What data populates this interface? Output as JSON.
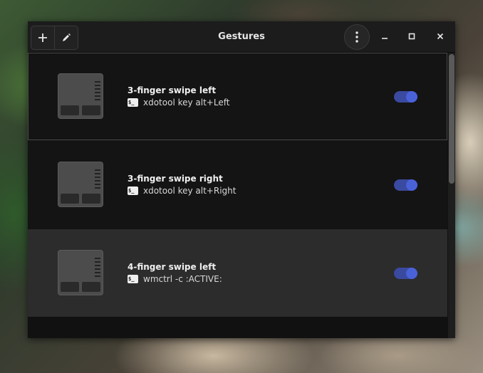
{
  "window": {
    "title": "Gestures"
  },
  "headerbar": {
    "add_icon": "plus-icon",
    "edit_icon": "pencil-icon",
    "menu_icon": "kebab-menu-icon",
    "minimize_icon": "minimize-icon",
    "maximize_icon": "maximize-icon",
    "close_icon": "close-icon"
  },
  "gestures": [
    {
      "name": "3-finger swipe left",
      "command": "xdotool key alt+Left",
      "enabled": true
    },
    {
      "name": "3-finger swipe right",
      "command": "xdotool key alt+Right",
      "enabled": true
    },
    {
      "name": "4-finger swipe left",
      "command": "wmctrl -c :ACTIVE:",
      "enabled": true
    }
  ],
  "terminal_icon_text": "$_",
  "colors": {
    "accent": "#4a62d8",
    "toggle_track": "#3a4aa0",
    "window_bg": "#141414",
    "headerbar_bg": "#1c1c1c"
  }
}
